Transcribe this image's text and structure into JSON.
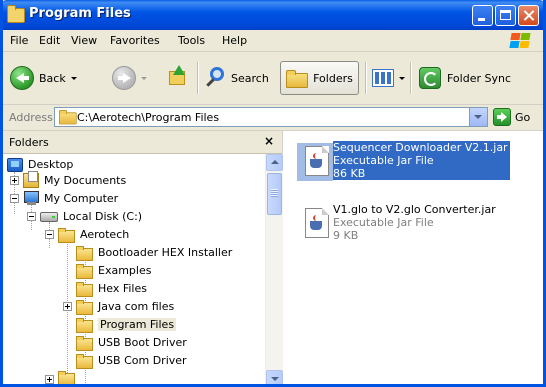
{
  "window": {
    "title": "Program Files"
  },
  "menu": {
    "items": [
      "File",
      "Edit",
      "View",
      "Favorites",
      "Tools",
      "Help"
    ]
  },
  "toolbar": {
    "back_label": "Back",
    "search_label": "Search",
    "folders_label": "Folders",
    "folder_sync_label": "Folder Sync"
  },
  "address": {
    "label": "Address",
    "value": "C:\\Aerotech\\Program Files",
    "go_label": "Go"
  },
  "folders_pane": {
    "title": "Folders",
    "close_glyph": "×",
    "tree": [
      {
        "label": "Desktop",
        "icon": "desktop-icon"
      },
      {
        "label": "My Documents",
        "icon": "my-documents-icon",
        "expander": "plus"
      },
      {
        "label": "My Computer",
        "icon": "my-computer-icon",
        "expander": "minus"
      },
      {
        "label": "Local Disk (C:)",
        "icon": "local-disk-icon",
        "expander": "minus"
      },
      {
        "label": "Aerotech",
        "icon": "folder-icon",
        "expander": "minus"
      },
      {
        "label": "Bootloader HEX Installer",
        "icon": "folder-icon"
      },
      {
        "label": "Examples",
        "icon": "folder-icon"
      },
      {
        "label": "Hex Files",
        "icon": "folder-icon"
      },
      {
        "label": "Java com files",
        "icon": "folder-icon",
        "expander": "plus"
      },
      {
        "label": "Program Files",
        "icon": "folder-icon",
        "selected": true
      },
      {
        "label": "USB Boot Driver",
        "icon": "folder-icon"
      },
      {
        "label": "USB Com Driver",
        "icon": "folder-icon"
      }
    ]
  },
  "files": [
    {
      "name": "Sequencer Downloader V2.1.jar",
      "type": "Executable Jar File",
      "size": "86 KB",
      "selected": true
    },
    {
      "name": "V1.glo to V2.glo Converter.jar",
      "type": "Executable Jar File",
      "size": "9 KB",
      "selected": false
    }
  ],
  "colors": {
    "title_bar": "#0055e5",
    "selection": "#316ac5",
    "chrome": "#ece9d8"
  }
}
